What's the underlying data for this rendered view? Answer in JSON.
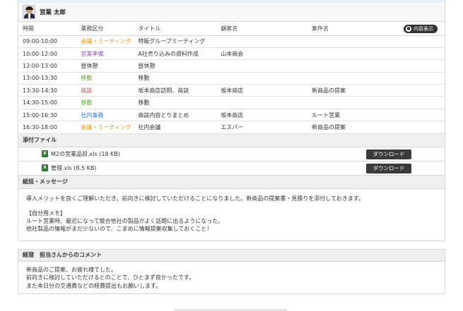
{
  "user": {
    "name": "営業 太郎"
  },
  "schedule": {
    "headers": {
      "time": "時間",
      "type": "業務区分",
      "title": "タイトル",
      "client": "顧客名",
      "case": "案件名"
    },
    "toggle_label": "内容表示",
    "rows": [
      {
        "time": "09:00-10:00",
        "type": "会議・ミーティング",
        "color": "#f39200",
        "title": "特販グループミーティング",
        "client": "",
        "case": ""
      },
      {
        "time": "10:00-12:00",
        "type": "営業準備",
        "color": "#a04ad6",
        "title": "A社売り込みの資料作成",
        "client": "山本商会",
        "case": ""
      },
      {
        "time": "12:00-13:00",
        "type": "昼休憩",
        "color": "#333333",
        "title": "昼休憩",
        "client": "",
        "case": ""
      },
      {
        "time": "13:00-13:30",
        "type": "移動",
        "color": "#5aa92a",
        "title": "移動",
        "client": "",
        "case": ""
      },
      {
        "time": "13:30-14:30",
        "type": "商談",
        "color": "#e53935",
        "title": "坂本商店訪問、商談",
        "client": "坂本商店",
        "case": "新商品の提案"
      },
      {
        "time": "14:30-15:00",
        "type": "移動",
        "color": "#5aa92a",
        "title": "移動",
        "client": "",
        "case": ""
      },
      {
        "time": "15:00-16:30",
        "type": "社内事務",
        "color": "#2d7fd4",
        "title": "商談内容とりまとめ",
        "client": "坂本商店",
        "case": "ルート営業"
      },
      {
        "time": "16:30-18:00",
        "type": "会議・ミーティング",
        "color": "#f39200",
        "title": "社内会議",
        "client": "エスパー",
        "case": "新商品の提案"
      }
    ]
  },
  "attachments": {
    "heading": "添付ファイル",
    "download_label": "ダウンロード",
    "files": [
      {
        "name": "M2の営業品目.xls (18 KB)",
        "icon": "excel-file-icon"
      },
      {
        "name": "管理.xls (8.5 KB)",
        "icon": "excel-file-icon"
      }
    ]
  },
  "summary": {
    "heading": "総括・メッセージ",
    "line1": "導入メリットを良くご理解いただき、前向きに検討していただけることになりました。新商品の提案書・見積りを添付しておきます。",
    "line2": "【自分用メモ】",
    "line3": "ルート営業時、最近になって競合他社の製品がよく話題に出るようになった。",
    "line4": "他社製品の情報がまだ少ないので、こまめに情報提案収集しておくこと！"
  },
  "comment": {
    "heading": "経理　担当さんからのコメント",
    "line1": "新商品のご提案、お疲れ様でした。",
    "line2": "前向きに検討していただけるとのことで、ひとまず良かったです。",
    "line3": "また本日分の交通費などの経費提出もお願いします。"
  }
}
